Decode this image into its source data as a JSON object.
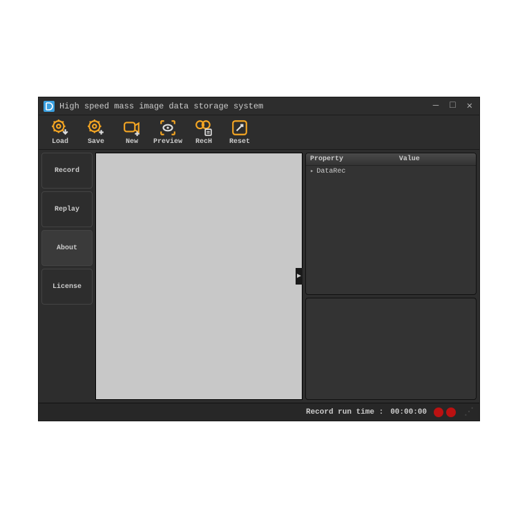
{
  "window": {
    "title": "High speed mass image data storage system"
  },
  "toolbar": {
    "load": "Load",
    "save": "Save",
    "new": "New",
    "preview": "Preview",
    "rech": "RecH",
    "reset": "Reset"
  },
  "sidebar": {
    "record": "Record",
    "replay": "Replay",
    "about": "About",
    "license": "License"
  },
  "properties": {
    "header_property": "Property",
    "header_value": "Value",
    "rows": [
      {
        "name": "DataRec",
        "value": ""
      }
    ]
  },
  "status": {
    "label": "Record run time :",
    "time": "00:00:00"
  },
  "colors": {
    "accent": "#f5a623"
  }
}
